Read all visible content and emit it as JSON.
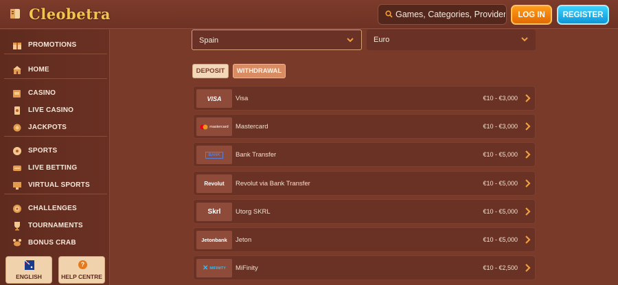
{
  "header": {
    "logo_text": "Cleobetra",
    "search_placeholder": "Games, Categories, Providers",
    "login_label": "LOG IN",
    "register_label": "REGISTER"
  },
  "sidebar": {
    "items": [
      {
        "label": "PROMOTIONS",
        "icon": "gift-icon"
      },
      {
        "label": "HOME",
        "icon": "home-icon"
      },
      {
        "label": "CASINO",
        "icon": "slot-machine-icon"
      },
      {
        "label": "LIVE CASINO",
        "icon": "cards-icon"
      },
      {
        "label": "JACKPOTS",
        "icon": "jackpot-icon"
      },
      {
        "label": "SPORTS",
        "icon": "ball-icon"
      },
      {
        "label": "LIVE BETTING",
        "icon": "live-icon"
      },
      {
        "label": "VIRTUAL SPORTS",
        "icon": "screen-icon"
      },
      {
        "label": "CHALLENGES",
        "icon": "target-icon"
      },
      {
        "label": "TOURNAMENTS",
        "icon": "trophy-icon"
      },
      {
        "label": "BONUS CRAB",
        "icon": "crab-icon"
      }
    ],
    "language_label": "ENGLISH",
    "help_label": "HELP CENTRE"
  },
  "filters": {
    "country": "Spain",
    "currency": "Euro"
  },
  "tabs": {
    "deposit": "DEPOSIT",
    "withdrawal": "WITHDRAWAL"
  },
  "payments": [
    {
      "logo": "VISA",
      "name": "Visa",
      "range": "€10 - €3,000"
    },
    {
      "logo": "mastercard",
      "name": "Mastercard",
      "range": "€10 - €3,000"
    },
    {
      "logo": "BANK",
      "name": "Bank Transfer",
      "range": "€10 - €5,000"
    },
    {
      "logo": "Revolut",
      "name": "Revolut via Bank Transfer",
      "range": "€10 - €5,000"
    },
    {
      "logo": "Skrl",
      "name": "Utorg SKRL",
      "range": "€10 - €5,000"
    },
    {
      "logo": "Jetonbank",
      "name": "Jeton",
      "range": "€10 - €5,000"
    },
    {
      "logo": "MIFINITY",
      "name": "MiFinity",
      "range": "€10 - €2,500"
    }
  ],
  "colors": {
    "background": "#7a3a2a",
    "accent_login": "#f08a10",
    "accent_register": "#1cb4ee",
    "logo_gold": "#f1c34f"
  }
}
